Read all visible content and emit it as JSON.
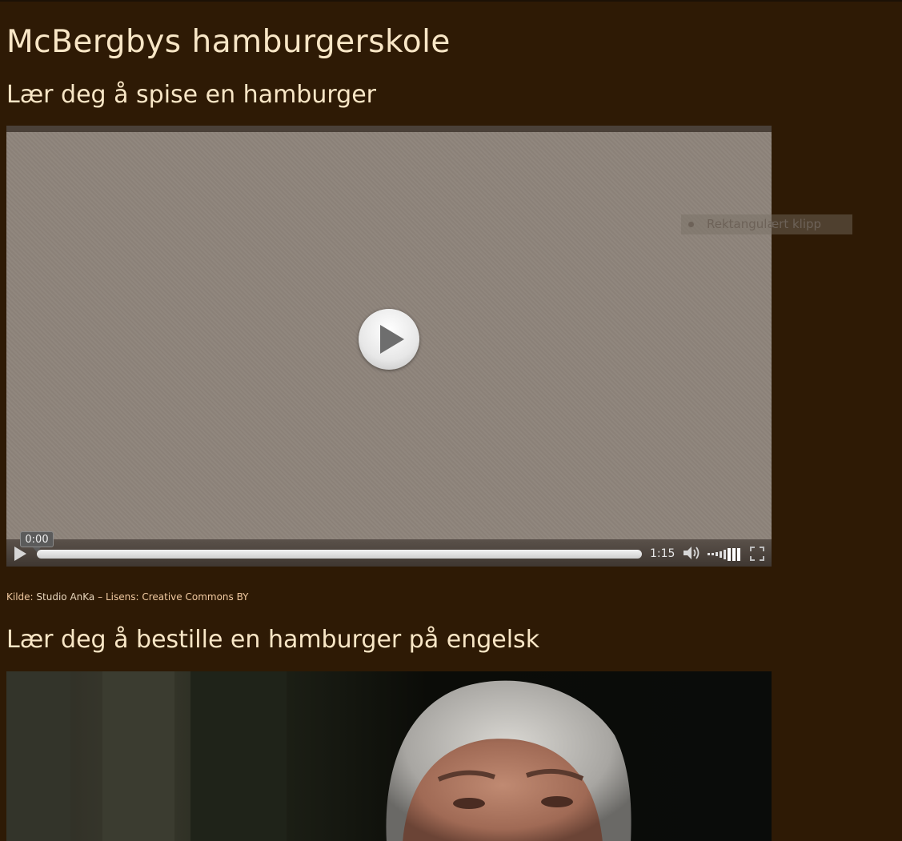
{
  "page": {
    "title": "McBergbys hamburgerskole"
  },
  "section1": {
    "title": "Lær deg å spise en hamburger",
    "player": {
      "current_time": "0:00",
      "duration": "1:15",
      "progress": 0.0
    },
    "tooltip": "Rektangulært klipp",
    "credit": {
      "source_label": "Kilde:",
      "source_name": "Studio AnKa",
      "separator": "–",
      "license_label": "Lisens:",
      "license_name": "Creative Commons BY"
    }
  },
  "section2": {
    "title": "Lær deg å bestille en hamburger på engelsk"
  },
  "icons": {
    "play": "play-icon",
    "volume": "volume-icon",
    "volume_level": "volume-level-icon",
    "fullscreen": "fullscreen-icon"
  },
  "colors": {
    "background": "#2e1a05",
    "heading": "#f8e6c6",
    "credit_text": "#f0c9a0"
  }
}
